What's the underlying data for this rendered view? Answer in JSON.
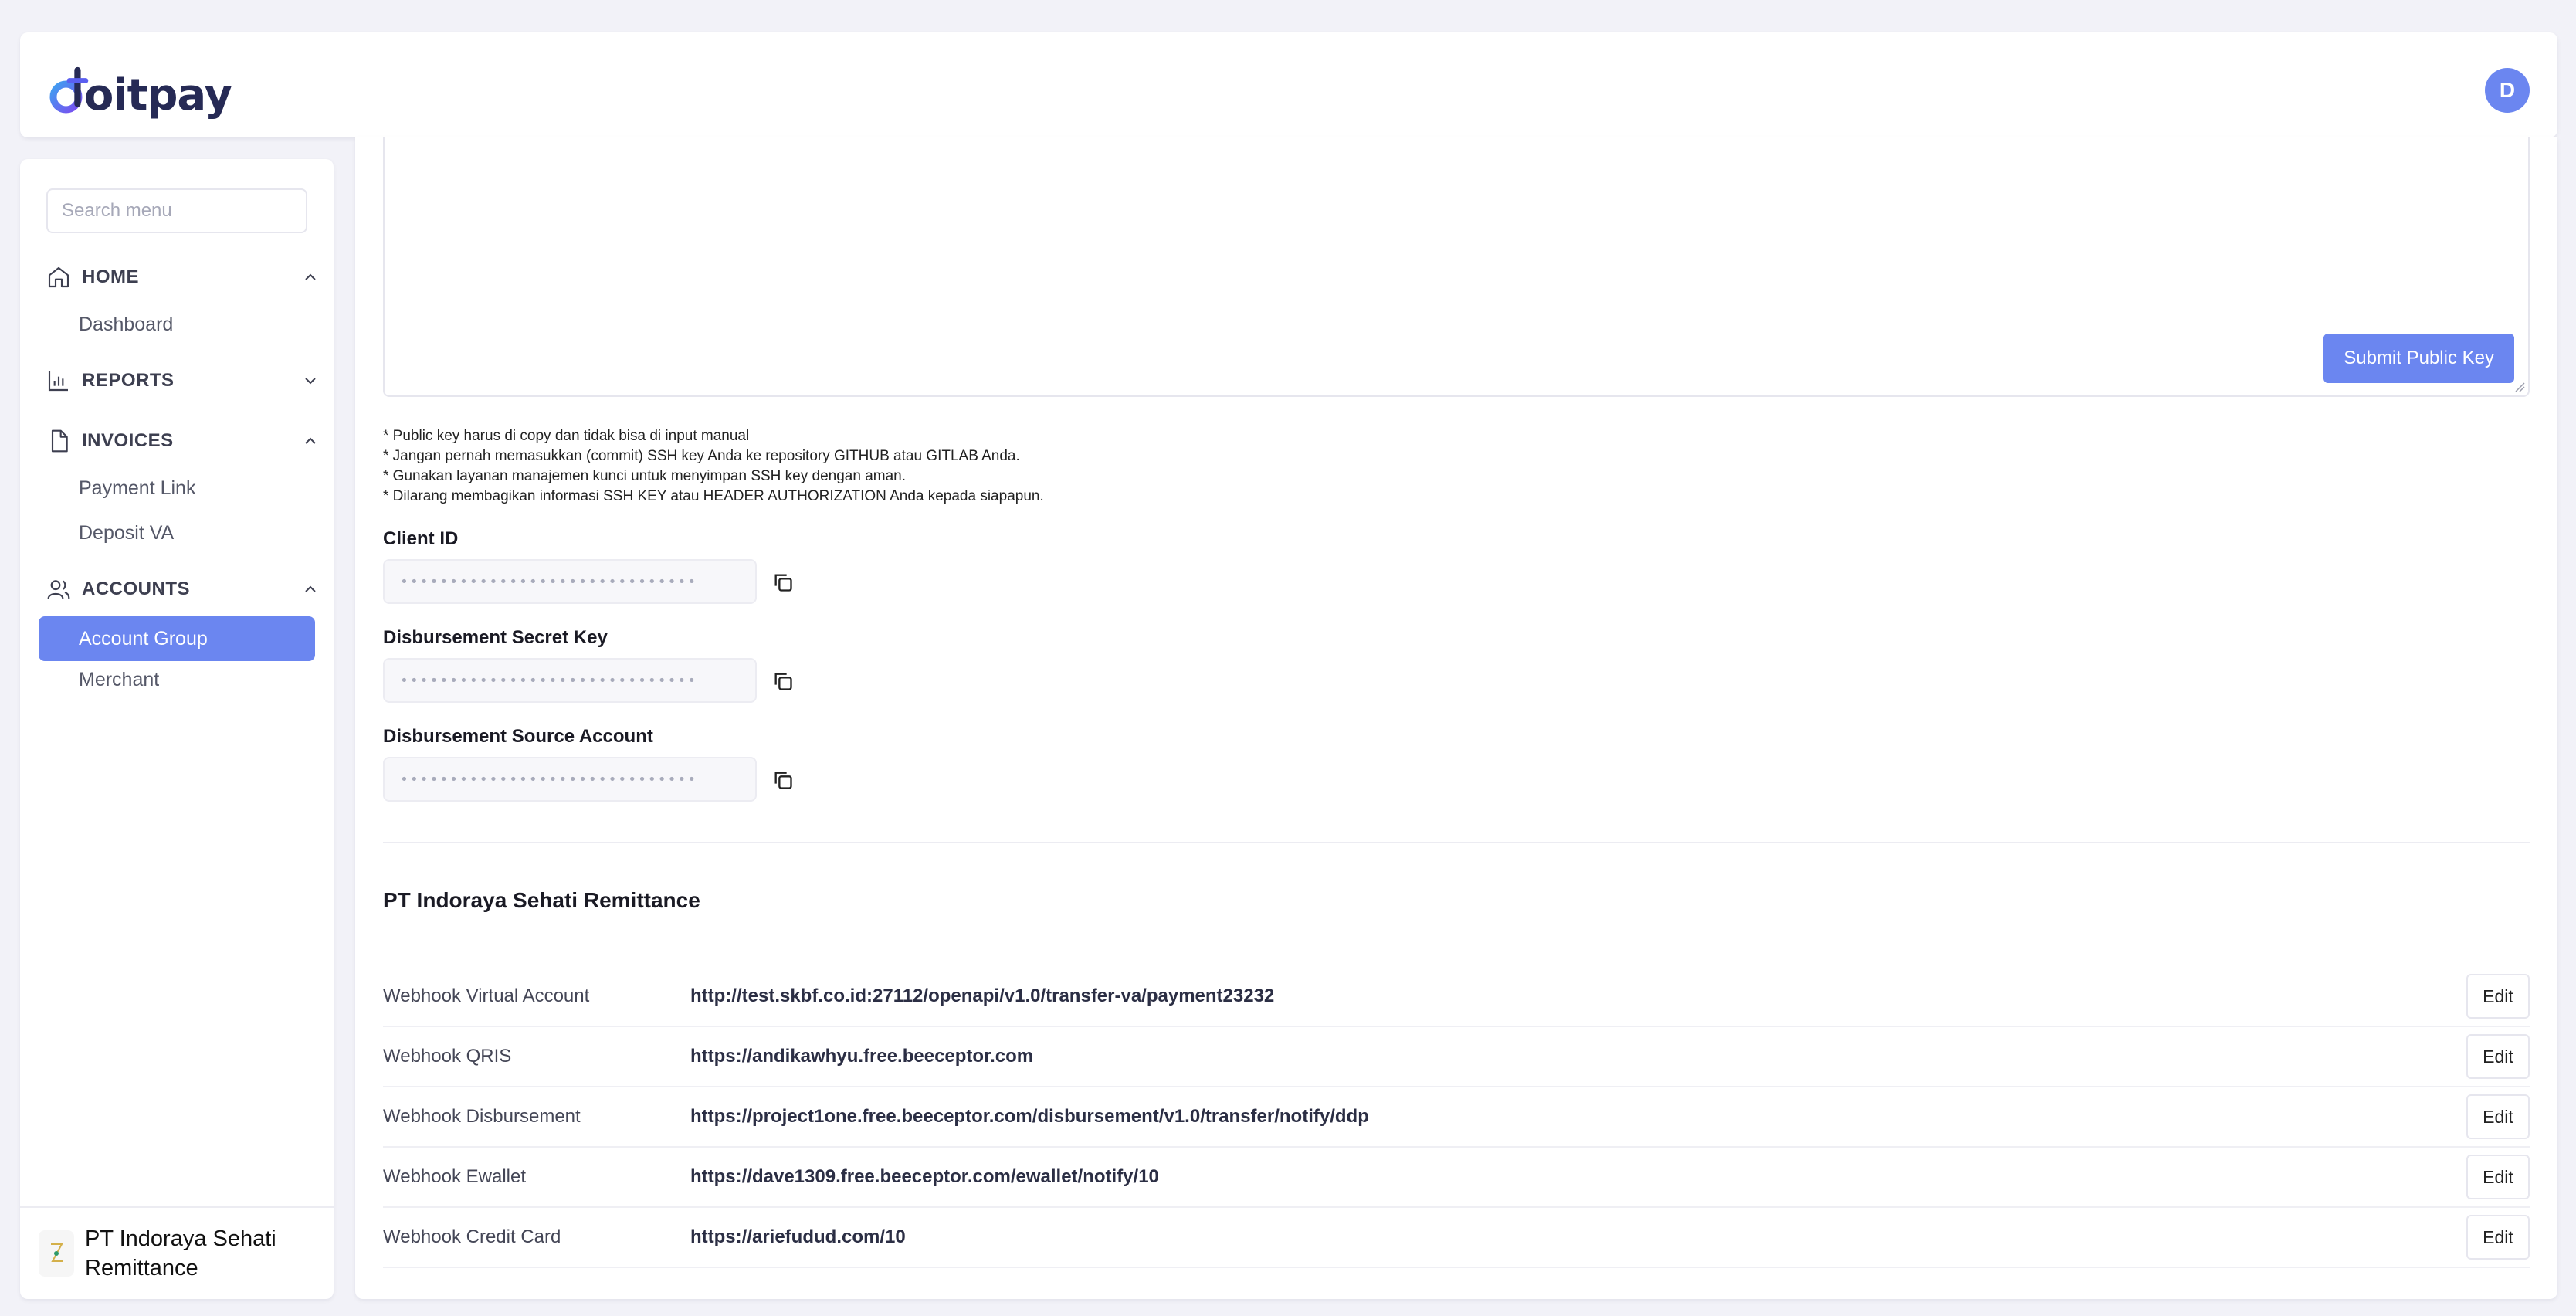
{
  "header": {
    "logo_text": "oitpay",
    "avatar_initial": "D"
  },
  "sidebar": {
    "search_placeholder": "Search menu",
    "sections": {
      "home": {
        "label": "HOME",
        "items": [
          "Dashboard"
        ]
      },
      "reports": {
        "label": "REPORTS"
      },
      "invoices": {
        "label": "INVOICES",
        "items": [
          "Payment Link",
          "Deposit VA"
        ]
      },
      "accounts": {
        "label": "ACCOUNTS",
        "items": [
          "Account Group",
          "Merchant"
        ]
      }
    },
    "active_item": "Account Group",
    "merchant_name_line1": "PT Indoraya Sehati",
    "merchant_name_line2": "Remittance"
  },
  "main": {
    "submit_label": "Submit Public Key",
    "notes": [
      "* Public key harus di copy dan tidak bisa di input manual",
      "* Jangan pernah memasukkan (commit) SSH key Anda ke repository GITHUB atau GITLAB Anda.",
      "* Gunakan layanan manajemen kunci untuk menyimpan SSH key dengan aman.",
      "* Dilarang membagikan informasi SSH KEY atau HEADER AUTHORIZATION Anda kepada siapapun."
    ],
    "fields": {
      "client_id": {
        "label": "Client ID",
        "value": "••••••••••••••••••••••••••••••"
      },
      "secret_key": {
        "label": "Disbursement Secret Key",
        "value": "••••••••••••••••••••••••••••••"
      },
      "source_account": {
        "label": "Disbursement Source Account",
        "value": "••••••••••••••••••••••••••••••"
      }
    },
    "company_name": "PT Indoraya Sehati Remittance",
    "webhooks": [
      {
        "label": "Webhook Virtual Account",
        "url": "http://test.skbf.co.id:27112/openapi/v1.0/transfer-va/payment23232",
        "action": "Edit"
      },
      {
        "label": "Webhook QRIS",
        "url": "https://andikawhyu.free.beeceptor.com",
        "action": "Edit"
      },
      {
        "label": "Webhook Disbursement",
        "url": "https://project1one.free.beeceptor.com/disbursement/v1.0/transfer/notify/ddp",
        "action": "Edit"
      },
      {
        "label": "Webhook Ewallet",
        "url": "https://dave1309.free.beeceptor.com/ewallet/notify/10",
        "action": "Edit"
      },
      {
        "label": "Webhook Credit Card",
        "url": "https://ariefudud.com/10",
        "action": "Edit"
      }
    ]
  },
  "colors": {
    "accent": "#6b86f0",
    "background": "#f2f2f8",
    "brand_dark": "#262a55"
  }
}
